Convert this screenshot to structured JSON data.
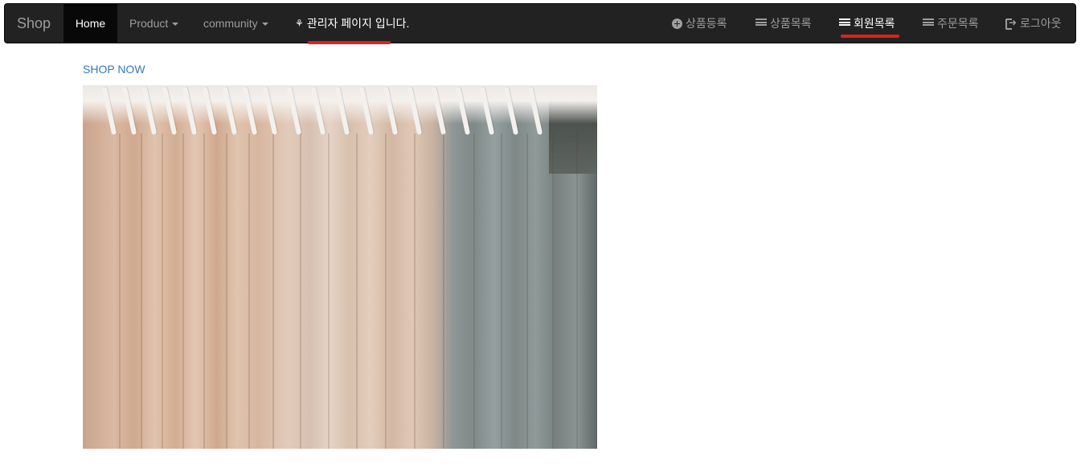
{
  "navbar": {
    "brand": "Shop",
    "home": "Home",
    "product": "Product",
    "community": "community",
    "admin_note": "관리자 페이지 입니다.",
    "right_items": [
      {
        "label": "상품등록",
        "icon": "plus-circle-icon"
      },
      {
        "label": "상품목록",
        "icon": "list-icon"
      },
      {
        "label": "회원목록",
        "icon": "list-icon"
      },
      {
        "label": "주문목록",
        "icon": "list-icon"
      },
      {
        "label": "로그아웃",
        "icon": "logout-icon"
      }
    ]
  },
  "main": {
    "shop_now": "SHOP NOW",
    "hero_image": "clothes-rack-photo"
  },
  "colors": {
    "navbar_bg": "#222222",
    "nav_text": "#9d9d9d",
    "active_text": "#ffffff",
    "link": "#337ab7",
    "annotation": "#e02020"
  }
}
